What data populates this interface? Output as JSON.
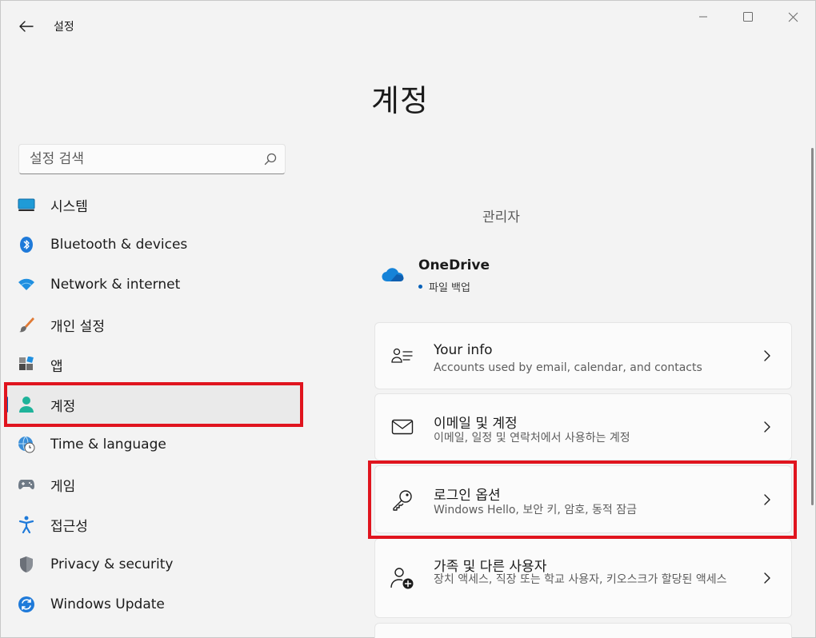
{
  "window": {
    "app_title": "설정"
  },
  "page": {
    "title": "계정"
  },
  "search": {
    "placeholder": "설정 검색"
  },
  "sidebar": {
    "items": [
      {
        "label": "시스템",
        "icon": "system-icon"
      },
      {
        "label": "Bluetooth & devices",
        "icon": "bluetooth-icon"
      },
      {
        "label": "Network & internet",
        "icon": "wifi-icon"
      },
      {
        "label": "개인 설정",
        "icon": "brush-icon"
      },
      {
        "label": "앱",
        "icon": "apps-icon"
      },
      {
        "label": "계정",
        "icon": "account-icon",
        "selected": true
      },
      {
        "label": "Time & language",
        "icon": "globe-clock-icon"
      },
      {
        "label": "게임",
        "icon": "gamepad-icon"
      },
      {
        "label": "접근성",
        "icon": "accessibility-icon"
      },
      {
        "label": "Privacy & security",
        "icon": "shield-icon"
      },
      {
        "label": "Windows Update",
        "icon": "update-icon"
      }
    ]
  },
  "account": {
    "user_label": "관리자"
  },
  "onedrive": {
    "title": "OneDrive",
    "status": "파일 백업"
  },
  "cards": [
    {
      "title": "Your info",
      "subtitle": "Accounts used by email, calendar, and contacts",
      "icon": "person-list-icon"
    },
    {
      "title": "이메일 및 계정",
      "subtitle": "이메일, 일정 및 연락처에서 사용하는 계정",
      "icon": "mail-icon"
    },
    {
      "title": "로그인 옵션",
      "subtitle": "Windows Hello, 보안 키, 암호, 동적 잠금",
      "icon": "key-icon"
    },
    {
      "title": "가족 및 다른 사용자",
      "subtitle": "장치 액세스, 직장 또는 학교 사용자, 키오스크가 할당된 액세스",
      "icon": "person-add-icon"
    }
  ],
  "colors": {
    "accent": "#005fb8",
    "highlight": "#e0141e",
    "background": "#f3f3f3",
    "card": "#fbfbfb"
  }
}
